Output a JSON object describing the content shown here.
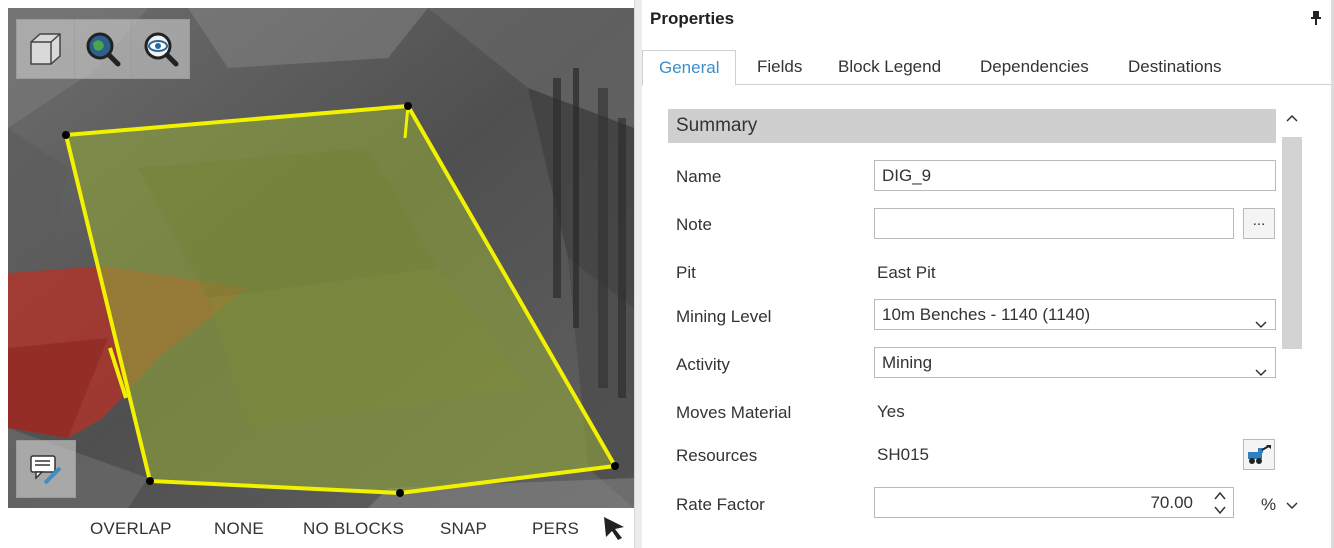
{
  "viewport": {
    "toolbar": [
      {
        "name": "3d-box-view-icon"
      },
      {
        "name": "zoom-globe-icon"
      },
      {
        "name": "zoom-eye-icon"
      }
    ],
    "note_button_icon": "comment-edit-icon",
    "colors": {
      "dig_fill": "#8fa33a",
      "dig_outline": "#f2f200",
      "red_block": "#b83228"
    }
  },
  "statusbar": {
    "items": [
      "OVERLAP",
      "NONE",
      "NO BLOCKS",
      "SNAP",
      "PERS"
    ],
    "cursor_icon": "arrow-cursor-icon"
  },
  "properties": {
    "title": "Properties",
    "tabs": [
      "General",
      "Fields",
      "Block Legend",
      "Dependencies",
      "Destinations"
    ],
    "active_tab": "General",
    "section": "Summary",
    "rows": {
      "name": {
        "label": "Name",
        "value": "DIG_9"
      },
      "note": {
        "label": "Note",
        "value": "",
        "button": "..."
      },
      "pit": {
        "label": "Pit",
        "value": "East Pit"
      },
      "mining_level": {
        "label": "Mining Level",
        "value": "10m Benches - 1140 (1140)"
      },
      "activity": {
        "label": "Activity",
        "value": "Mining"
      },
      "moves_material": {
        "label": "Moves Material",
        "value": "Yes"
      },
      "resources": {
        "label": "Resources",
        "value": "SH015"
      },
      "rate_factor": {
        "label": "Rate Factor",
        "value": "70.00",
        "unit": "%"
      }
    },
    "accent": "#3b8fc9"
  }
}
